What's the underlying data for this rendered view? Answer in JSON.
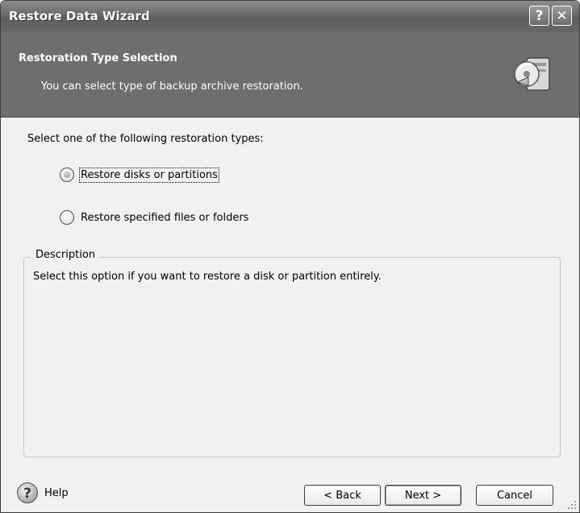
{
  "window": {
    "title": "Restore Data Wizard"
  },
  "titlebar_buttons": {
    "help": "?",
    "close": "✕"
  },
  "banner": {
    "title": "Restoration Type Selection",
    "subtitle": "You can select type of backup archive restoration."
  },
  "main": {
    "prompt": "Select one of the following restoration types:",
    "options": [
      {
        "label": "Restore disks or partitions",
        "selected": true
      },
      {
        "label": "Restore specified files or folders",
        "selected": false
      }
    ]
  },
  "description": {
    "legend": "Description",
    "text": "Select this option if you want to restore a disk or partition entirely."
  },
  "footer": {
    "help_label": "Help",
    "help_icon_glyph": "?",
    "back_label": "< Back",
    "next_label": "Next >",
    "cancel_label": "Cancel"
  },
  "icons": {
    "help": "help-circle-icon",
    "wizard": "restore-computer-icon"
  }
}
